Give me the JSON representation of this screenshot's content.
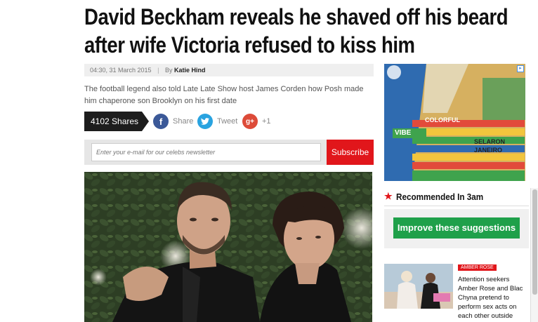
{
  "article": {
    "headline": "David Beckham reveals he shaved off his beard after wife Victoria refused to kiss him",
    "date": "04:30, 31 March 2015",
    "by_label": "By",
    "author": "Katie Hind",
    "summary": "The football legend also told Late Late Show host James Corden how Posh made him chaperone son Brooklyn on his first date"
  },
  "share_bar": {
    "shares_count": "4102 Shares",
    "facebook_label": "Share",
    "twitter_label": "Tweet",
    "gplus_label": "+1",
    "gplus_icon": "g+"
  },
  "newsletter": {
    "placeholder": "Enter your e-mail for our celebs newsletter",
    "button_label": "Subscribe"
  },
  "ad": {
    "sign_texts": [
      "COLORFUL",
      "VIBE",
      "SELARON",
      "JANEIRO"
    ]
  },
  "sidebar": {
    "recommended_title": "Recommended In 3am",
    "improve_label": "Improve these suggestions",
    "story": {
      "tag": "AMBER ROSE",
      "text": "Attention seekers Amber Rose and Blac Chyna pretend to perform sex acts on each other outside"
    }
  },
  "colors": {
    "brand_red": "#e1161b",
    "improve_green": "#1fa04a",
    "facebook_blue": "#3b5998",
    "twitter_blue": "#29a3e0",
    "gplus_red": "#dd4b39"
  }
}
